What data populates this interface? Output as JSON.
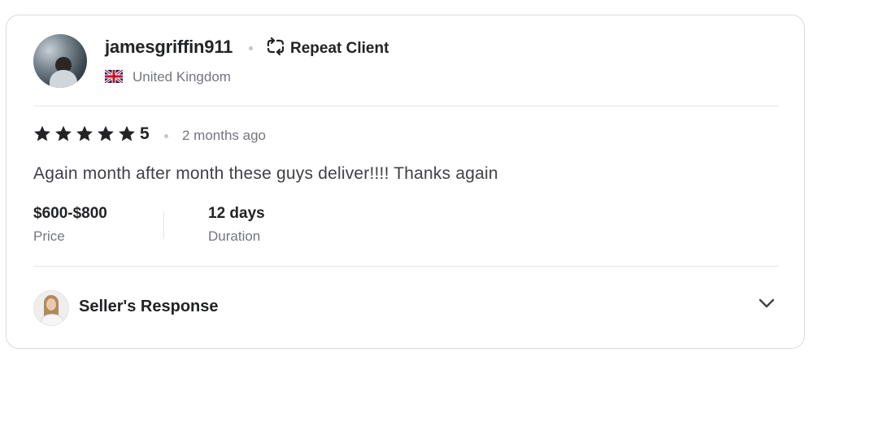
{
  "review": {
    "username": "jamesgriffin911",
    "badge": "Repeat Client",
    "country": "United Kingdom",
    "rating": "5",
    "stars_filled": 5,
    "time_ago": "2 months ago",
    "text": "Again month after month these guys deliver!!!! Thanks again",
    "price": {
      "value": "$600-$800",
      "label": "Price"
    },
    "duration": {
      "value": "12 days",
      "label": "Duration"
    }
  },
  "seller_response": {
    "title": "Seller's Response"
  },
  "icons": {
    "repeat": "repeat-client-icon",
    "flag": "uk-flag-icon",
    "star": "star-icon",
    "chevron": "chevron-down-icon"
  },
  "colors": {
    "text_primary": "#222325",
    "text_secondary": "#74767e",
    "border": "#dadbdd"
  }
}
